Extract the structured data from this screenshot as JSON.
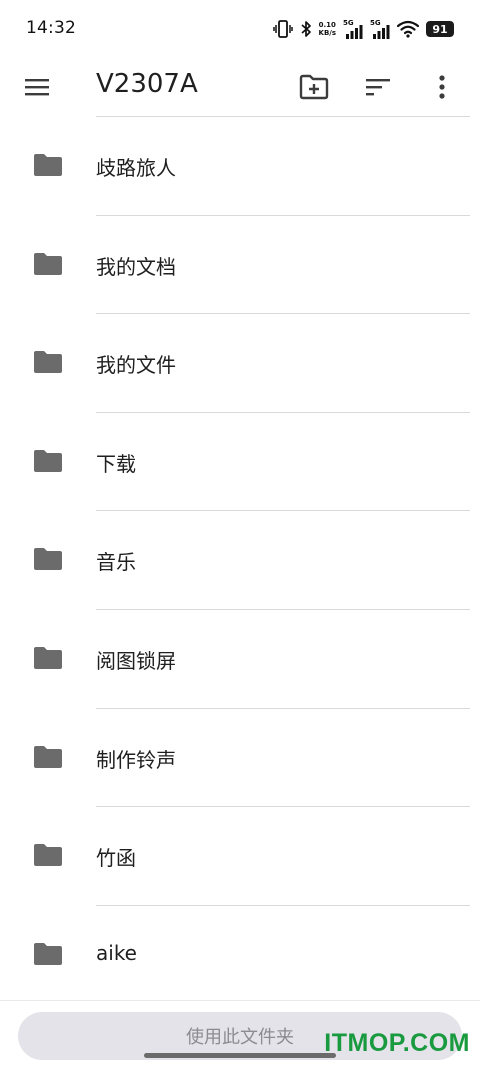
{
  "status_bar": {
    "time": "14:32",
    "net_speed_value": "0.10",
    "net_speed_unit": "KB/s",
    "sim1_label": "5G",
    "sim2_label": "5G",
    "battery": "91"
  },
  "app_bar": {
    "title": "V2307A",
    "icons": [
      "menu-icon",
      "new-folder-icon",
      "sort-icon",
      "more-vert-icon"
    ]
  },
  "folders": [
    {
      "name": "歧路旅人"
    },
    {
      "name": "我的文档"
    },
    {
      "name": "我的文件"
    },
    {
      "name": "下载"
    },
    {
      "name": "音乐"
    },
    {
      "name": "阅图锁屏"
    },
    {
      "name": "制作铃声"
    },
    {
      "name": "竹函"
    },
    {
      "name": "aike"
    }
  ],
  "bottom": {
    "use_folder_label": "使用此文件夹",
    "watermark": "ITMOP.COM"
  },
  "colors": {
    "folder_icon": "#6b6b6b",
    "divider": "#d9d9d9",
    "button_bg": "#e4e3ea",
    "button_text": "#8c8b92",
    "watermark": "#1a9a3f"
  }
}
